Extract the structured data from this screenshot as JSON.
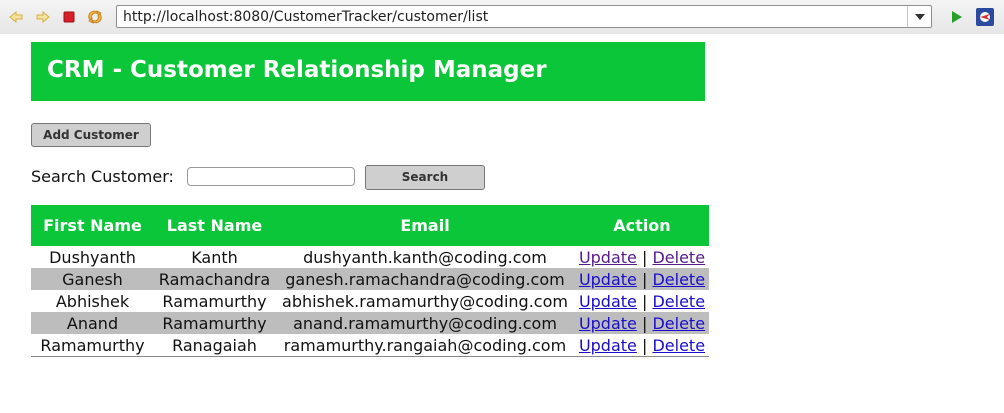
{
  "browser": {
    "url": "http://localhost:8080/CustomerTracker/customer/list"
  },
  "page": {
    "title": "CRM - Customer Relationship Manager",
    "add_customer_label": "Add Customer",
    "search_label": "Search Customer:",
    "search_value": "",
    "search_button_label": "Search"
  },
  "table": {
    "headers": [
      "First Name",
      "Last Name",
      "Email",
      "Action"
    ],
    "update_label": "Update",
    "delete_label": "Delete",
    "separator": "|",
    "rows": [
      {
        "first_name": "Dushyanth",
        "last_name": "Kanth",
        "email": "dushyanth.kanth@coding.com"
      },
      {
        "first_name": "Ganesh",
        "last_name": "Ramachandra",
        "email": "ganesh.ramachandra@coding.com"
      },
      {
        "first_name": "Abhishek",
        "last_name": "Ramamurthy",
        "email": "abhishek.ramamurthy@coding.com"
      },
      {
        "first_name": "Anand",
        "last_name": "Ramamurthy",
        "email": "anand.ramamurthy@coding.com"
      },
      {
        "first_name": "Ramamurthy",
        "last_name": "Ranagaiah",
        "email": "ramamurthy.rangaiah@coding.com"
      }
    ]
  },
  "colors": {
    "accent": "#0ac638",
    "alt_row": "#bdbdbd",
    "link": "#1a0dcc",
    "visited_link": "#551a8b"
  },
  "icons": [
    "back-arrow-icon",
    "forward-arrow-icon",
    "stop-icon",
    "refresh-icon",
    "dropdown-arrow-icon",
    "go-icon",
    "browser-logo-icon"
  ]
}
